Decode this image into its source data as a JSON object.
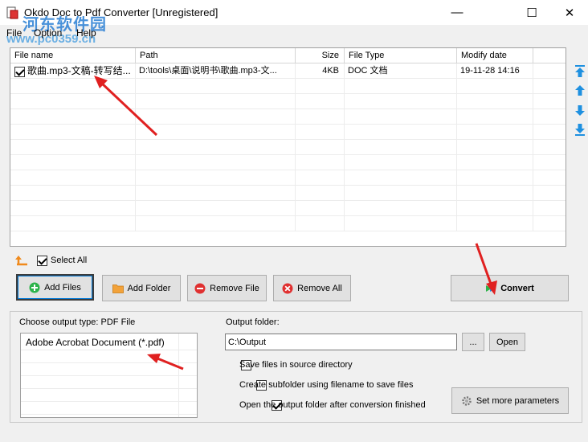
{
  "window": {
    "title": "Okdo Doc to Pdf Converter [Unregistered]",
    "minimize_glyph": "—",
    "maximize_glyph": "☐",
    "close_glyph": "✕"
  },
  "watermark": {
    "line1": "河东软件园",
    "line2": "www.pc0359.cn"
  },
  "menu": {
    "file": "File",
    "option": "Option",
    "help": "Help"
  },
  "file_list": {
    "columns": [
      "File name",
      "Path",
      "Size",
      "File Type",
      "Modify date"
    ],
    "rows": [
      {
        "checked": true,
        "name": "歌曲.mp3-文稿-转写结...",
        "path": "D:\\tools\\桌面\\说明书\\歌曲.mp3-文...",
        "size": "4KB",
        "type": "DOC 文档",
        "date": "19-11-28 14:16"
      }
    ]
  },
  "nav_icons": [
    "move-top-icon",
    "move-up-icon",
    "move-down-icon",
    "move-bottom-icon"
  ],
  "select_all": {
    "label": "Select All",
    "checked": true
  },
  "buttons": {
    "add_files": "Add Files",
    "add_folder": "Add Folder",
    "remove_file": "Remove File",
    "remove_all": "Remove All",
    "convert": "Convert",
    "browse": "...",
    "open": "Open",
    "set_more_parameters": "Set more parameters"
  },
  "output_type": {
    "label": "Choose output type:  PDF File",
    "options": [
      "Adobe Acrobat Document (*.pdf)"
    ]
  },
  "output_folder": {
    "label": "Output folder:",
    "value": "C:\\Output"
  },
  "options": [
    {
      "label": "Save files in source directory",
      "checked": false
    },
    {
      "label": "Create subfolder using filename to save files",
      "checked": false
    },
    {
      "label": "Open the output folder after conversion finished",
      "checked": true
    }
  ],
  "colors": {
    "annotation_arrow": "#e02020",
    "nav_arrow": "#1e90e0",
    "add_icon": "#2db34a",
    "remove_icon": "#e03030",
    "folder_icon": "#f2a23a"
  }
}
